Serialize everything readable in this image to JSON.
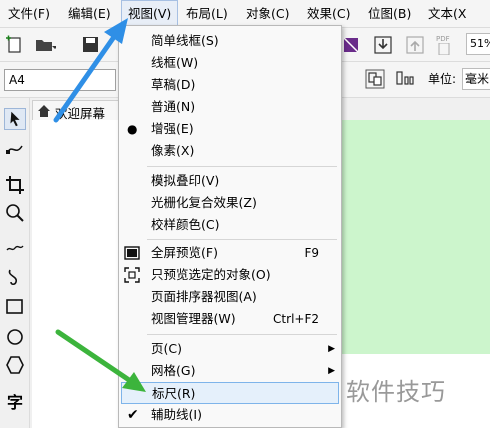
{
  "menubar": {
    "items": [
      "文件(F)",
      "编辑(E)",
      "视图(V)",
      "布局(L)",
      "对象(C)",
      "效果(C)",
      "位图(B)",
      "文本(X"
    ]
  },
  "toolbar": {
    "zoom_value": "51%",
    "pdf_label": "PDF"
  },
  "propbar": {
    "page_size": "A4",
    "units_label": "单位:",
    "units_value": "毫米"
  },
  "doc_tab": {
    "label": "欢迎屏幕"
  },
  "view_menu": {
    "groups": [
      [
        {
          "label": "简单线框(S)"
        },
        {
          "label": "线框(W)"
        },
        {
          "label": "草稿(D)"
        },
        {
          "label": "普通(N)"
        },
        {
          "label": "增强(E)",
          "mark": "●"
        },
        {
          "label": "像素(X)"
        }
      ],
      [
        {
          "label": "模拟叠印(V)"
        },
        {
          "label": "光栅化复合效果(Z)"
        },
        {
          "label": "校样颜色(C)"
        }
      ],
      [
        {
          "label": "全屏预览(F)",
          "shortcut": "F9"
        },
        {
          "label": "只预览选定的对象(O)"
        },
        {
          "label": "页面排序器视图(A)"
        },
        {
          "label": "视图管理器(W)",
          "shortcut": "Ctrl+F2"
        }
      ],
      [
        {
          "label": "页(C)",
          "submenu": true
        },
        {
          "label": "网格(G)",
          "submenu": true
        },
        {
          "label": "标尺(R)",
          "highlighted": true
        },
        {
          "label": "辅助线(I)",
          "mark": "✔"
        }
      ]
    ]
  },
  "watermark": "软件技巧",
  "colors": {
    "canvas_green": "#ccf5cc",
    "arrow_blue": "#2f8fe6",
    "arrow_green": "#3cb43c"
  }
}
